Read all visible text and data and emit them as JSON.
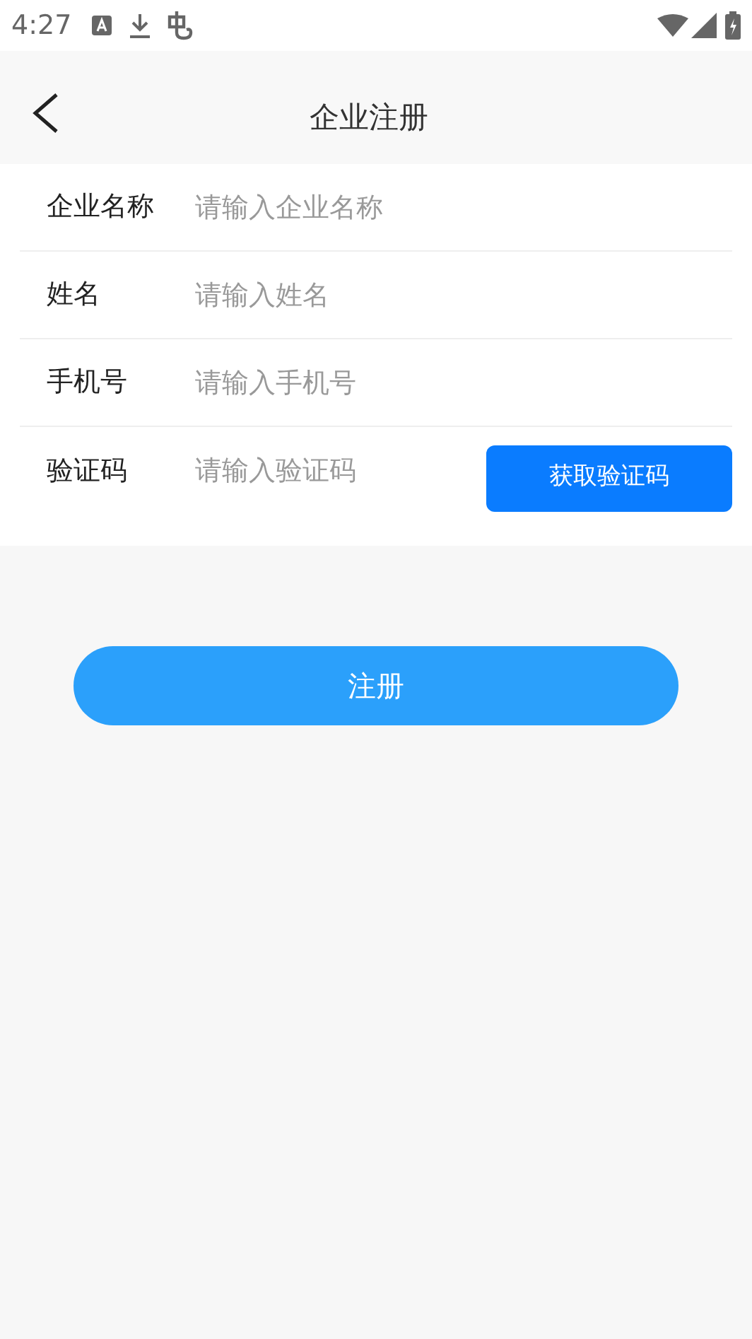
{
  "status_bar": {
    "time": "4:27"
  },
  "header": {
    "title": "企业注册"
  },
  "fields": [
    {
      "kind": "text",
      "label": "企业名称",
      "placeholder": "请输入企业名称"
    },
    {
      "kind": "text",
      "label": "姓名",
      "placeholder": "请输入姓名"
    },
    {
      "kind": "text",
      "label": "手机号",
      "placeholder": "请输入手机号"
    },
    {
      "kind": "code",
      "label": "验证码",
      "placeholder": "请输入验证码",
      "button": "获取验证码"
    }
  ],
  "submit": "注册"
}
